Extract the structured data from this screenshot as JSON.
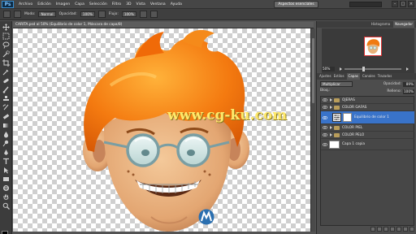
{
  "menubar": {
    "logo": "Ps",
    "items": [
      "Archivo",
      "Edición",
      "Imagen",
      "Capa",
      "Selección",
      "Filtro",
      "3D",
      "Vista",
      "Ventana",
      "Ayuda"
    ],
    "workspace": "Aspectos esenciales"
  },
  "options": {
    "mode_label": "Modo:",
    "mode_value": "Normal",
    "opacity_label": "Opacidad:",
    "opacity_value": "100%",
    "flow_label": "Flujo:",
    "flow_value": "100%"
  },
  "document": {
    "tab_title": "CARITA.psd al 50% (Equilibrio de color 1, Máscara de capa/8)",
    "watermark": "www.cg-ku.com"
  },
  "navigator": {
    "zoom": "50%"
  },
  "panel_tabs": [
    "Histograma",
    "Navegador"
  ],
  "layers_panel": {
    "tabs": [
      "Ajustes",
      "Estilos",
      "Capas",
      "Canales",
      "Trazados"
    ],
    "active_tab": "Capas",
    "blend_mode": "Multiplicar",
    "opacity_label": "Opacidad:",
    "opacity": "89%",
    "fill_label": "Relleno:",
    "fill": "100%",
    "lock_label": "Bloq.:",
    "layers": [
      {
        "name": "OJERAS",
        "kind": "group",
        "selected": false
      },
      {
        "name": "COLOR GAFAS",
        "kind": "group",
        "selected": false
      },
      {
        "name": "Equilibrio de color 1",
        "kind": "adjustment",
        "selected": true
      },
      {
        "name": "COLOR PIEL",
        "kind": "group",
        "selected": false
      },
      {
        "name": "COLOR PELO",
        "kind": "group",
        "selected": false
      },
      {
        "name": "Capa 1 copia",
        "kind": "layer",
        "selected": false
      }
    ]
  },
  "colors": {
    "accent": "#3973c9",
    "hair": "#f07a12",
    "skin": "#e8b27a"
  }
}
